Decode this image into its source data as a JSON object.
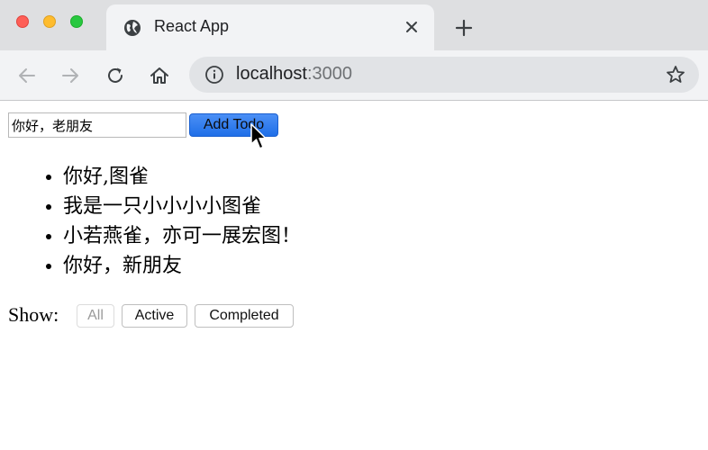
{
  "browser": {
    "tab": {
      "title": "React App",
      "favicon": "globe-icon"
    },
    "toolbar": {
      "url_host": "localhost",
      "url_port": ":3000"
    }
  },
  "todo": {
    "input_value": "你好，老朋友",
    "add_button_label": "Add Todo",
    "items": [
      "你好,图雀",
      "我是一只小小小小图雀",
      "小若燕雀，亦可一展宏图！",
      "你好，新朋友"
    ],
    "filters": {
      "label": "Show:",
      "all": "All",
      "active": "Active",
      "completed": "Completed"
    }
  },
  "colors": {
    "accent_button": "#1f6fe8",
    "tabstrip": "#dedfe1",
    "toolbar": "#f2f3f5"
  }
}
